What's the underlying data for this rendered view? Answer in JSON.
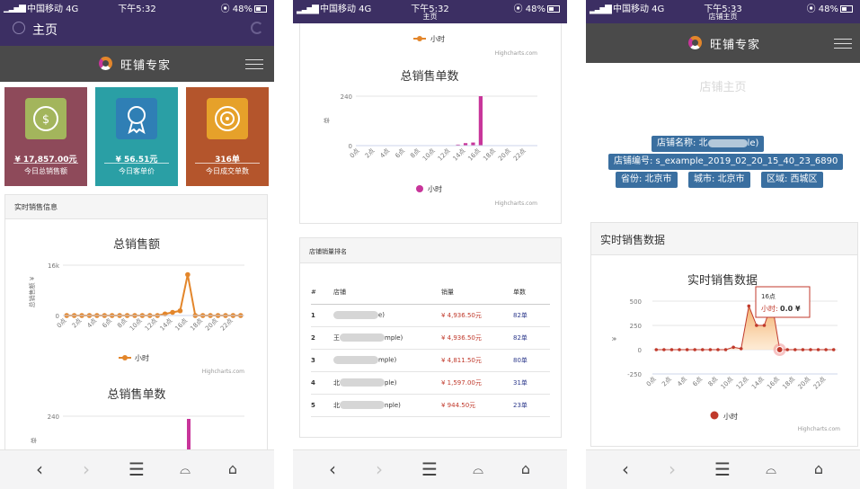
{
  "status_bars": [
    {
      "carrier": "中国移动",
      "network": "4G",
      "time": "下午5:32",
      "subtitle": "",
      "battery": "48%"
    },
    {
      "carrier": "中国移动",
      "network": "4G",
      "time": "下午5:32",
      "subtitle": "主页",
      "battery": "48%"
    },
    {
      "carrier": "中国移动",
      "network": "4G",
      "time": "下午5:33",
      "subtitle": "店铺主页",
      "battery": "48%"
    }
  ],
  "screen1": {
    "nav_title": "主页",
    "brand": "旺铺专家",
    "cards": [
      {
        "value": "¥ 17,857.00元",
        "label": "今日总销售额",
        "icon": "dollar-cycle-icon"
      },
      {
        "value": "¥ 56.51元",
        "label": "今日客单价",
        "icon": "award-ribbon-icon"
      },
      {
        "value": "316单",
        "label": "今日成交单数",
        "icon": "target-icon"
      }
    ],
    "panel_title": "实时销售信息",
    "sales_chart_title": "总销售额",
    "sales_ylabel": "总销售额 ¥",
    "sales_yticks": [
      "16k",
      "0"
    ],
    "sales_legend": "小时",
    "credit": "Highcharts.com",
    "orders_chart_title": "总销售单数",
    "orders_ytick": "240",
    "orders_ylabel": "单"
  },
  "screen2": {
    "legend_top": "小时",
    "credit_top": "Highcharts.com",
    "orders_chart_title": "总销售单数",
    "orders_yticks": [
      "240",
      "0"
    ],
    "orders_ylabel": "单",
    "orders_legend": "小时",
    "credit": "Highcharts.com",
    "ranking_title": "店铺销量排名",
    "ranking_headers": [
      "#",
      "店铺",
      "销量",
      "单数"
    ],
    "ranking_rows": [
      {
        "rank": "1",
        "store_start": "",
        "store_end": "e)",
        "sales": "¥ 4,936.50元",
        "orders": "82单"
      },
      {
        "rank": "2",
        "store_start": "王",
        "store_end": "mple)",
        "sales": "¥ 4,936.50元",
        "orders": "82单"
      },
      {
        "rank": "3",
        "store_start": "",
        "store_end": "mple)",
        "sales": "¥ 4,811.50元",
        "orders": "80单"
      },
      {
        "rank": "4",
        "store_start": "北",
        "store_end": "ple)",
        "sales": "¥ 1,597.00元",
        "orders": "31单"
      },
      {
        "rank": "5",
        "store_start": "北",
        "store_end": "nple)",
        "sales": "¥ 944.50元",
        "orders": "23单"
      }
    ]
  },
  "screen3": {
    "brand": "旺铺专家",
    "page_title": "店铺主页",
    "store_name_label": "店铺名称: 北",
    "store_name_end": "le)",
    "store_id": "店铺编号: s_example_2019_02_20_15_40_23_6890",
    "province": "省份: 北京市",
    "city": "城市: 北京市",
    "district": "区域: 西城区",
    "panel_title": "实时销售数据",
    "chart_title": "实时销售数据",
    "yticks": [
      "500",
      "250",
      "0",
      "-250"
    ],
    "ylabel": "¥",
    "legend": "小时",
    "credit": "Highcharts.com",
    "tooltip_title": "16点",
    "tooltip_series": "小时:",
    "tooltip_value": "0.0 ¥"
  },
  "hour_labels": [
    "0点",
    "2点",
    "4点",
    "6点",
    "8点",
    "10点",
    "12点",
    "14点",
    "16点",
    "18点",
    "20点",
    "22点"
  ],
  "colors": {
    "purple": "#3c2f63",
    "dark_header": "#4a4a4a",
    "orange": "#e3862b",
    "magenta": "#c8359a",
    "red": "#c0392b",
    "info_blue": "#3a6fa0"
  },
  "chart_data": [
    {
      "type": "line",
      "title": "总销售额",
      "ylabel": "总销售额 ¥",
      "x": [
        0,
        1,
        2,
        3,
        4,
        5,
        6,
        7,
        8,
        9,
        10,
        11,
        12,
        13,
        14,
        15,
        16,
        17,
        18,
        19,
        20,
        21,
        22,
        23
      ],
      "series": [
        {
          "name": "小时",
          "values": [
            0,
            0,
            0,
            0,
            0,
            0,
            0,
            0,
            0,
            0,
            0,
            0,
            0,
            500,
            1000,
            1500,
            13000,
            0,
            0,
            0,
            0,
            0,
            0,
            0
          ]
        }
      ],
      "ylim": [
        0,
        16000
      ]
    },
    {
      "type": "bar",
      "title": "总销售单数",
      "ylabel": "单",
      "x": [
        0,
        1,
        2,
        3,
        4,
        5,
        6,
        7,
        8,
        9,
        10,
        11,
        12,
        13,
        14,
        15,
        16,
        17,
        18,
        19,
        20,
        21,
        22,
        23
      ],
      "series": [
        {
          "name": "小时",
          "values": [
            0,
            0,
            0,
            0,
            0,
            0,
            0,
            0,
            0,
            0,
            0,
            0,
            0,
            5,
            12,
            15,
            240,
            0,
            0,
            0,
            0,
            0,
            0,
            0
          ]
        }
      ],
      "ylim": [
        0,
        240
      ]
    },
    {
      "type": "area",
      "title": "实时销售数据",
      "ylabel": "¥",
      "x": [
        0,
        1,
        2,
        3,
        4,
        5,
        6,
        7,
        8,
        9,
        10,
        11,
        12,
        13,
        14,
        15,
        16,
        17,
        18,
        19,
        20,
        21,
        22,
        23
      ],
      "series": [
        {
          "name": "小时",
          "values": [
            0,
            0,
            0,
            0,
            0,
            0,
            0,
            0,
            0,
            0,
            25,
            10,
            450,
            250,
            250,
            480,
            0,
            0,
            0,
            0,
            0,
            0,
            0,
            0
          ]
        }
      ],
      "ylim": [
        -250,
        500
      ]
    }
  ]
}
